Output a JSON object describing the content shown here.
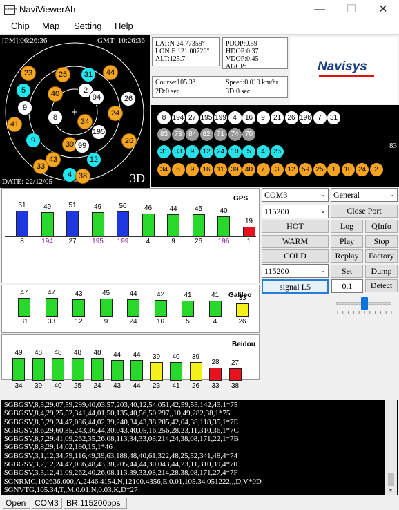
{
  "window": {
    "title": "NaviViewerAh",
    "icon_text": "Navisys",
    "min": "—",
    "max": "☐",
    "close": "✕"
  },
  "menu": [
    "Chip",
    "Map",
    "Setting",
    "Help"
  ],
  "sky": {
    "local_time": "[PM]:06:26:36",
    "gmt_time": "GMT: 10:26:36",
    "date": "DATE: 22/12/05",
    "fix": "3D",
    "satellites": [
      {
        "prn": "23",
        "color": "orange"
      },
      {
        "prn": "25",
        "color": "orange"
      },
      {
        "prn": "31",
        "color": "cyan"
      },
      {
        "prn": "44",
        "color": "orange"
      },
      {
        "prn": "5",
        "color": "cyan"
      },
      {
        "prn": "40",
        "color": "orange"
      },
      {
        "prn": "2",
        "color": "white"
      },
      {
        "prn": "94",
        "color": "white"
      },
      {
        "prn": "26",
        "color": "white"
      },
      {
        "prn": "9",
        "color": "white"
      },
      {
        "prn": "24",
        "color": "orange"
      },
      {
        "prn": "8",
        "color": "white"
      },
      {
        "prn": "34",
        "color": "orange"
      },
      {
        "prn": "41",
        "color": "orange"
      },
      {
        "prn": "195",
        "color": "white"
      },
      {
        "prn": "9",
        "color": "cyan"
      },
      {
        "prn": "39",
        "color": "orange"
      },
      {
        "prn": "99",
        "color": "white"
      },
      {
        "prn": "26",
        "color": "orange"
      },
      {
        "prn": "43",
        "color": "orange"
      },
      {
        "prn": "12",
        "color": "cyan"
      },
      {
        "prn": "33",
        "color": "orange"
      },
      {
        "prn": "4",
        "color": "cyan"
      },
      {
        "prn": "38",
        "color": "orange"
      }
    ]
  },
  "position": {
    "lat": "LAT:N 24.77359°",
    "lon": "LON:E 121.00726°",
    "alt": "ALT:125.7"
  },
  "dop": {
    "pdop": "PDOP:0.59",
    "hdop": "HDOP:0.37",
    "vdop": "VDOP:0.45",
    "agcp": "AGCP:"
  },
  "motion": {
    "course": "Course:105.3°",
    "speed": "Speed:0.019 km/hr",
    "fix2d": "2D:0 sec",
    "fix3d": "3D:0 sec"
  },
  "logo": "Navisys",
  "prn_strip": {
    "side_value": "83",
    "rows": [
      {
        "color": "white",
        "prns": [
          "8",
          "194",
          "27",
          "195",
          "199",
          "4",
          "16",
          "9",
          "21",
          "26",
          "196",
          "7",
          "31"
        ]
      },
      {
        "color": "gray",
        "prns": [
          "83",
          "73",
          "84",
          "82",
          "71",
          "74",
          "70"
        ]
      },
      {
        "color": "cyan",
        "prns": [
          "31",
          "33",
          "9",
          "12",
          "24",
          "10",
          "5",
          "4",
          "26"
        ]
      },
      {
        "color": "orange",
        "prns": [
          "34",
          "6",
          "9",
          "16",
          "11",
          "39",
          "40",
          "7",
          "3",
          "12",
          "59",
          "25",
          "1",
          "10",
          "24",
          "2"
        ]
      }
    ]
  },
  "signals": {
    "gps": {
      "label": "GPS",
      "bars": [
        {
          "snr": 51,
          "prn": "8",
          "color": "blue",
          "prn_color": "#000"
        },
        {
          "snr": 49,
          "prn": "194",
          "color": "green",
          "prn_color": "#7a1a90"
        },
        {
          "snr": 51,
          "prn": "27",
          "color": "blue",
          "prn_color": "#000"
        },
        {
          "snr": 49,
          "prn": "195",
          "color": "green",
          "prn_color": "#7a1a90"
        },
        {
          "snr": 50,
          "prn": "199",
          "color": "blue",
          "prn_color": "#7a1a90"
        },
        {
          "snr": 46,
          "prn": "4",
          "color": "green",
          "prn_color": "#000"
        },
        {
          "snr": 44,
          "prn": "9",
          "color": "green",
          "prn_color": "#000"
        },
        {
          "snr": 45,
          "prn": "26",
          "color": "green",
          "prn_color": "#000"
        },
        {
          "snr": 40,
          "prn": "196",
          "color": "green",
          "prn_color": "#7a1a90"
        },
        {
          "snr": 19,
          "prn": "1",
          "color": "red",
          "prn_color": "#000"
        }
      ]
    },
    "galileo": {
      "label": "Galileo",
      "bars": [
        {
          "snr": 47,
          "prn": "31",
          "color": "green"
        },
        {
          "snr": 47,
          "prn": "33",
          "color": "green"
        },
        {
          "snr": 43,
          "prn": "12",
          "color": "green"
        },
        {
          "snr": 45,
          "prn": "9",
          "color": "green"
        },
        {
          "snr": 44,
          "prn": "24",
          "color": "green"
        },
        {
          "snr": 42,
          "prn": "10",
          "color": "green"
        },
        {
          "snr": 41,
          "prn": "5",
          "color": "green"
        },
        {
          "snr": 41,
          "prn": "4",
          "color": "green"
        },
        {
          "snr": 33,
          "prn": "26",
          "color": "yellow"
        }
      ]
    },
    "beidou": {
      "label": "Beidou",
      "bars": [
        {
          "snr": 49,
          "prn": "34",
          "color": "green"
        },
        {
          "snr": 48,
          "prn": "39",
          "color": "green"
        },
        {
          "snr": 48,
          "prn": "40",
          "color": "green"
        },
        {
          "snr": 48,
          "prn": "25",
          "color": "green"
        },
        {
          "snr": 48,
          "prn": "24",
          "color": "green"
        },
        {
          "snr": 44,
          "prn": "43",
          "color": "green"
        },
        {
          "snr": 44,
          "prn": "44",
          "color": "green"
        },
        {
          "snr": 39,
          "prn": "23",
          "color": "yellow"
        },
        {
          "snr": 40,
          "prn": "41",
          "color": "green"
        },
        {
          "snr": 39,
          "prn": "26",
          "color": "yellow"
        },
        {
          "snr": 28,
          "prn": "33",
          "color": "red"
        },
        {
          "snr": 27,
          "prn": "38",
          "color": "red"
        }
      ]
    }
  },
  "controls": {
    "port_combo": "COM3",
    "mode_combo": "General",
    "baud_combo": "115200",
    "close_port": "Close Port",
    "hot": "HOT",
    "log": "Log",
    "qinfo": "QInfo",
    "warm": "WARM",
    "play": "Play",
    "stop": "Stop",
    "cold": "COLD",
    "replay": "Replay",
    "factory": "Factory",
    "baud_combo2": "115200",
    "set": "Set",
    "dump": "Dump",
    "signal_l5": "signal L5",
    "threshold": "0.1",
    "detect": "Detect"
  },
  "log_lines": [
    "$GBGSV,8,3,29,07,59,299,40,03,57,203,40,12,54,051,42,59,53,142,43,1*75",
    "$GBGSV,8,4,29,25,52,341,44,01,50,135,40,56,50,297,,10,49,282,38,1*75",
    "$GBGSV,8,5,29,24,47,086,44,02,39,240,34,43,38,205,42,04,38,118,35,1*7E",
    "$GBGSV,8,6,29,60,35,243,36,44,30,043,40,05,16,256,28,23,11,310,36,1*7C",
    "$GBGSV,8,7,29,41,09,262,35,26,08,113,34,33,08,214,24,38,08,171,22,1*7B",
    "$GBGSV,8,8,29,14,02,190,15,1*46",
    "$GBGSV,3,1,12,34,79,116,49,39,63,188,48,40,61,322,48,25,52,341,48,4*74",
    "$GBGSV,3,2,12,24,47,086,48,43,38,205,44,44,30,043,44,23,11,310,39,4*70",
    "$GBGSV,3,3,12,41,09,262,40,26,08,113,39,33,08,214,28,38,08,171,27,4*7F",
    "$GNRMC,102636.000,A,2446.4154,N,12100.4356,E,0.01,105.34,051222,,,D,V*0D",
    "$GNVTG,105.34,T,,M,0.01,N,0.03,K,D*27"
  ],
  "status": {
    "state": "Open",
    "port": "COM3",
    "baud": "BR:115200bps"
  }
}
